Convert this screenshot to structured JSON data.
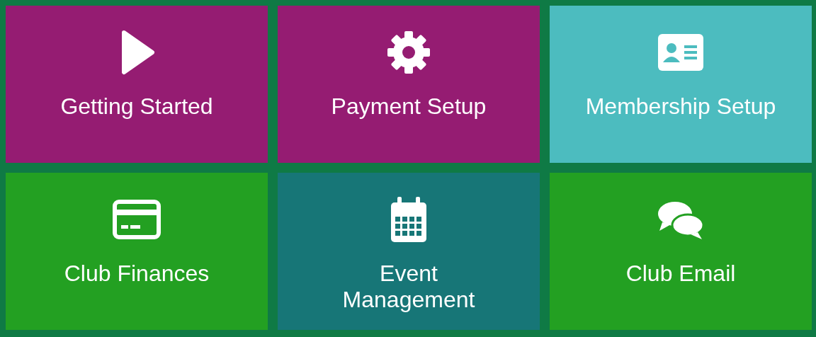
{
  "tiles": [
    {
      "label": "Getting Started",
      "color": "#951c72"
    },
    {
      "label": "Payment Setup",
      "color": "#951c72"
    },
    {
      "label": "Membership Setup",
      "color": "#4cbcbf"
    },
    {
      "label": "Club Finances",
      "color": "#23a022"
    },
    {
      "label": "Event\nManagement",
      "color": "#177677"
    },
    {
      "label": "Club Email",
      "color": "#23a022"
    }
  ]
}
